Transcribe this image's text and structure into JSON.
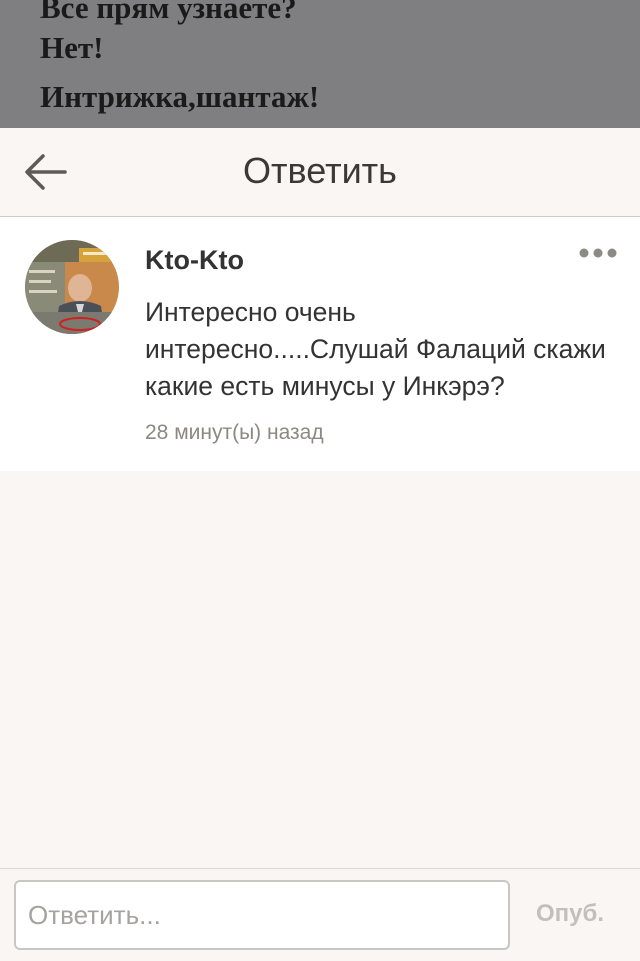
{
  "background_post": {
    "lines": [
      "Все прям узнаете?",
      "Нет!",
      "Интрижка,шантаж!"
    ]
  },
  "header": {
    "back_icon": "arrow-left-icon",
    "title": "Ответить"
  },
  "comment": {
    "author": "Kto-Kto",
    "text": "Интересно очень интересно.....Слушай Фалаций скажи какие есть минусы у Инкэрэ?",
    "time": "28 минут(ы) назад",
    "more_icon": "more-dots-icon",
    "avatar": "user-avatar-photo"
  },
  "reply_bar": {
    "placeholder": "Ответить...",
    "publish_label": "Опуб."
  },
  "colors": {
    "background": "#f9f6f3",
    "card": "#ffffff",
    "title": "#3c3835",
    "muted": "#8c8884",
    "disabled_button": "#c3bfbc"
  }
}
